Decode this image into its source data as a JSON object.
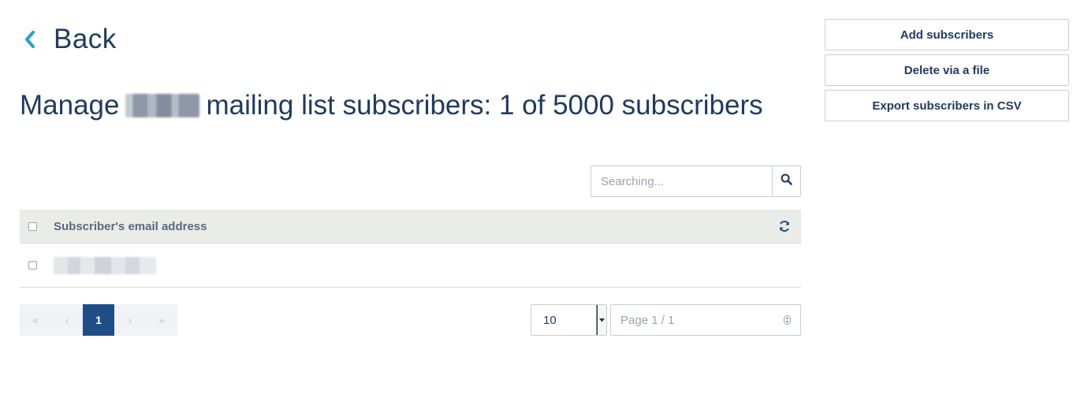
{
  "header": {
    "back_label": "Back",
    "title_prefix": "Manage",
    "title_suffix": "mailing list subscribers: 1 of 5000 subscribers"
  },
  "actions": {
    "add_label": "Add subscribers",
    "delete_label": "Delete via a file",
    "export_label": "Export subscribers in CSV"
  },
  "search": {
    "placeholder": "Searching..."
  },
  "table": {
    "column_header": "Subscriber's email address",
    "rows": [
      {
        "email": ""
      }
    ]
  },
  "pagination": {
    "first": "«",
    "prev": "‹",
    "current": "1",
    "next": "›",
    "last": "»",
    "per_page": "10",
    "page_indicator": "Page 1 / 1"
  },
  "colors": {
    "accent": "#2aa0c9",
    "text": "#1f3a5f",
    "active_page": "#1f4e86",
    "table_header_bg": "#eaece7"
  },
  "icons": {
    "back": "chevron-left-icon",
    "search": "search-icon",
    "refresh": "refresh-icon"
  }
}
